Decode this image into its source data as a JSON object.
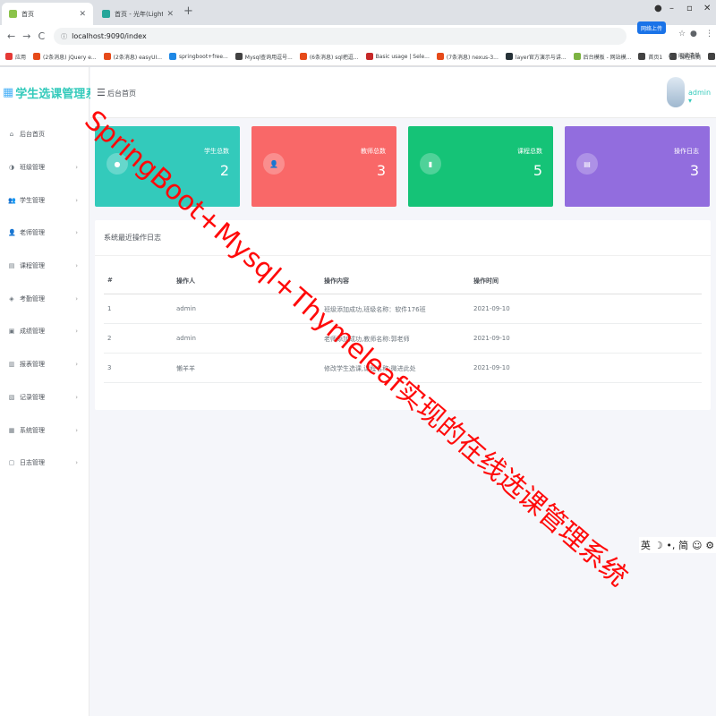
{
  "browser": {
    "tabs": [
      {
        "title": "首页",
        "active": true,
        "close": "✕",
        "favicon_color": "#8bc34a"
      },
      {
        "title": "首页 - 光年(Light Year Admin)",
        "active": false,
        "close": "✕",
        "favicon_color": "#26a69a"
      }
    ],
    "new_tab": "+",
    "window_controls": {
      "minimize": "–",
      "maximize": "▫",
      "close": "✕"
    },
    "address": {
      "back": "←",
      "forward": "→",
      "reload": "C",
      "url": "localhost:9090/index",
      "lock": "ⓘ"
    },
    "extension_pill": "网络上传",
    "address_right": {
      "star": "☆",
      "puzzle": "◉",
      "profile": "●",
      "menu": "⋮"
    },
    "bookmarks": [
      {
        "label": "应用",
        "color": "#e53935"
      },
      {
        "label": "(2条消息) jQuery e...",
        "color": "#e64a19"
      },
      {
        "label": "(2条消息) easyUI...",
        "color": "#e64a19"
      },
      {
        "label": "springboot+free...",
        "color": "#1e88e5"
      },
      {
        "label": "Mysql查询用逗号...",
        "color": "#424242"
      },
      {
        "label": "(6条消息) sql把逗...",
        "color": "#e64a19"
      },
      {
        "label": "Basic usage | Sele...",
        "color": "#c62828"
      },
      {
        "label": "(7条消息) nexus-3...",
        "color": "#e64a19"
      },
      {
        "label": "layer官方演示与讲...",
        "color": "#263238"
      },
      {
        "label": "后台模板 - 网站模...",
        "color": "#7cb342"
      },
      {
        "label": "首页1",
        "color": "#424242"
      },
      {
        "label": "课程招商",
        "color": "#424242"
      },
      {
        "label": "新标签页",
        "color": "#424242"
      },
      {
        "label": "组件文档 | RuoYi",
        "color": "#00897b"
      }
    ],
    "bookmarks_more": "»",
    "reading_list": "阅读清单"
  },
  "sidebar": {
    "logo_icon": "calendar-icon",
    "logo_text": "学生选课管理系统",
    "chevron": "›",
    "items": [
      {
        "label": "后台首页",
        "icon": "home-icon",
        "glyph": "⌂",
        "has_children": false
      },
      {
        "label": "班级管理",
        "icon": "palette-icon",
        "glyph": "◑",
        "has_children": true
      },
      {
        "label": "学生管理",
        "icon": "users-icon",
        "glyph": "👥",
        "has_children": true
      },
      {
        "label": "老师管理",
        "icon": "teacher-icon",
        "glyph": "👤",
        "has_children": true
      },
      {
        "label": "课程管理",
        "icon": "book-icon",
        "glyph": "▤",
        "has_children": true
      },
      {
        "label": "考勤管理",
        "icon": "attendance-icon",
        "glyph": "◈",
        "has_children": true
      },
      {
        "label": "成绩管理",
        "icon": "score-icon",
        "glyph": "▣",
        "has_children": true
      },
      {
        "label": "报表管理",
        "icon": "report-icon",
        "glyph": "▥",
        "has_children": true
      },
      {
        "label": "记录管理",
        "icon": "record-icon",
        "glyph": "▧",
        "has_children": true
      },
      {
        "label": "系统管理",
        "icon": "system-icon",
        "glyph": "▦",
        "has_children": true
      },
      {
        "label": "日志管理",
        "icon": "log-icon",
        "glyph": "▢",
        "has_children": true
      }
    ]
  },
  "header": {
    "menu_icon": "☰",
    "title": "后台首页",
    "user": "admin ▾"
  },
  "cards": [
    {
      "label": "学生总数",
      "value": "2",
      "color": "#33cabb",
      "icon": "student-icon",
      "glyph": "●"
    },
    {
      "label": "教师总数",
      "value": "3",
      "color": "#f96868",
      "icon": "teacher-icon",
      "glyph": "👤"
    },
    {
      "label": "课程总数",
      "value": "5",
      "color": "#15c377",
      "icon": "course-icon",
      "glyph": "▮"
    },
    {
      "label": "操作日志",
      "value": "3",
      "color": "#926dde",
      "icon": "log-icon",
      "glyph": "▤"
    }
  ],
  "log_panel": {
    "title": "系统最近操作日志",
    "columns": [
      "#",
      "操作人",
      "操作内容",
      "操作时间"
    ],
    "rows": [
      [
        "1",
        "admin",
        "班级添加成功,班级名称：软件176班",
        "2021-09-10"
      ],
      [
        "2",
        "admin",
        "老师添加成功,教师名称:郭老师",
        "2021-09-10"
      ],
      [
        "3",
        "懒羊羊",
        "修改学生选课,课程名称:微进此处",
        "2021-09-10"
      ]
    ]
  },
  "ime_bar": {
    "lang": "英",
    "moon": "☽",
    "punct": "•,",
    "simp": "简",
    "emoji": "☺",
    "settings": "⚙"
  },
  "watermark": "SpringBoot+Mysql+Thymeleaf实现的在线选课管理系统"
}
